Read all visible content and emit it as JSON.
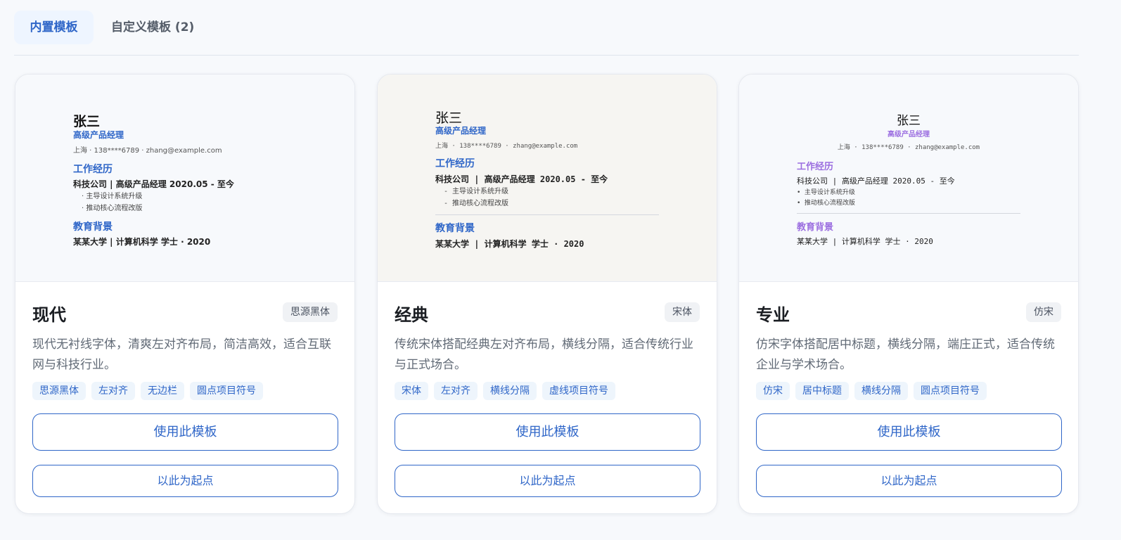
{
  "tabs": {
    "builtin": "内置模板",
    "custom": "自定义模板 (2)"
  },
  "preview": {
    "name": "张三",
    "role": "高级产品经理",
    "contact_modern": "上海 · 138****6789 · zhang@example.com",
    "contact_mono": "上海 · 138****6789 · zhang@example.com",
    "section_work": "工作经历",
    "job_modern": "科技公司 | 高级产品经理 2020.05 - 至今",
    "job_classic": "科技公司 | 高级产品经理 2020.05 - 至今",
    "job_pro": "科技公司 | 高级产品经理 2020.05 - 至今",
    "bullets_dot": [
      "· 主导设计系统升级",
      "· 推动核心流程改版"
    ],
    "bullets_dash": [
      "- 主导设计系统升级",
      "- 推动核心流程改版"
    ],
    "bullets_pro": [
      "• 主导设计系统升级",
      "• 推动核心流程改版"
    ],
    "section_edu": "教育背景",
    "edu_modern": "某某大学 | 计算机科学 学士 · 2020",
    "edu_classic": "某某大学 | 计算机科学 学士 · 2020",
    "edu_pro": "某某大学 | 计算机科学 学士 · 2020"
  },
  "cards": [
    {
      "title": "现代",
      "font": "思源黑体",
      "desc": "现代无衬线字体，清爽左对齐布局，简洁高效，适合互联网与科技行业。",
      "tags": [
        "思源黑体",
        "左对齐",
        "无边栏",
        "圆点项目符号"
      ],
      "use_label": "使用此模板",
      "start_label": "以此为起点",
      "accent": "#2f66c8",
      "preview_bg": "#f7f9fc"
    },
    {
      "title": "经典",
      "font": "宋体",
      "desc": "传统宋体搭配经典左对齐布局，横线分隔，适合传统行业与正式场合。",
      "tags": [
        "宋体",
        "左对齐",
        "横线分隔",
        "虚线项目符号"
      ],
      "use_label": "使用此模板",
      "start_label": "以此为起点",
      "accent": "#2f66c8",
      "preview_bg": "#f6f5f2"
    },
    {
      "title": "专业",
      "font": "仿宋",
      "desc": "仿宋字体搭配居中标题，横线分隔，端庄正式，适合传统企业与学术场合。",
      "tags": [
        "仿宋",
        "居中标题",
        "横线分隔",
        "圆点项目符号"
      ],
      "use_label": "使用此模板",
      "start_label": "以此为起点",
      "accent": "#9b6ee0",
      "preview_bg": "#f7f9fc"
    }
  ]
}
